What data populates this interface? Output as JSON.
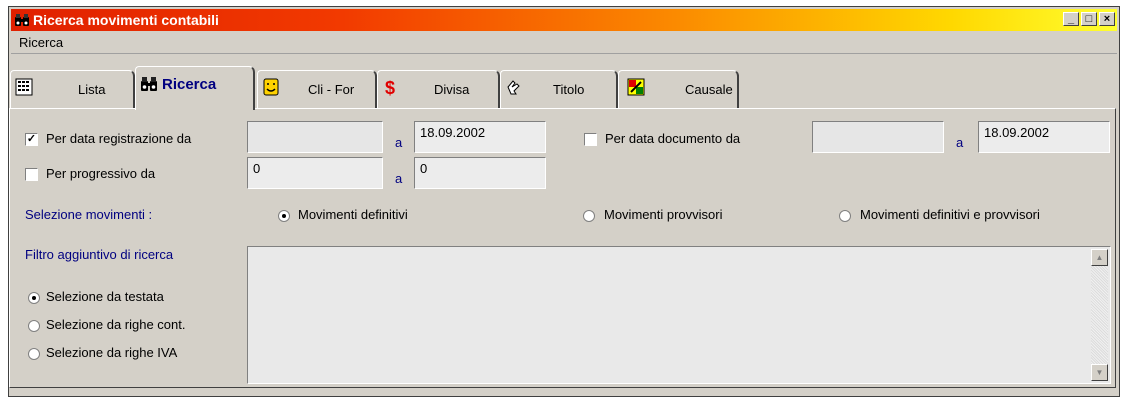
{
  "window": {
    "title": "Ricerca movimenti contabili"
  },
  "menu": {
    "items": [
      "Ricerca"
    ]
  },
  "tabs": [
    {
      "label": "Lista",
      "icon": "grid-list-icon"
    },
    {
      "label": "Ricerca",
      "icon": "binoculars-icon",
      "active": true
    },
    {
      "label": "Cli - For",
      "icon": "face-icon"
    },
    {
      "label": "Divisa",
      "icon": "dollar-icon"
    },
    {
      "label": "Titolo",
      "icon": "hand-icon"
    },
    {
      "label": "Causale",
      "icon": "ledger-icon"
    }
  ],
  "form": {
    "data_reg": {
      "label": "Per data registrazione da",
      "checked": true,
      "from": "",
      "to_label": "a",
      "to": "18.09.2002"
    },
    "progressivo": {
      "label": "Per progressivo da",
      "checked": false,
      "from": "0",
      "to_label": "a",
      "to": "0"
    },
    "data_doc": {
      "label": "Per data documento  da",
      "checked": false,
      "from": "",
      "to_label": "a",
      "to": "18.09.2002"
    },
    "selezione_label": "Selezione movimenti :",
    "selezione_options": [
      {
        "label": "Movimenti definitivi",
        "selected": true
      },
      {
        "label": "Movimenti provvisori",
        "selected": false
      },
      {
        "label": "Movimenti definitivi e provvisori",
        "selected": false
      }
    ],
    "filtro_label": "Filtro aggiuntivo di ricerca",
    "filtro_options": [
      {
        "label": "Selezione da testata",
        "selected": true
      },
      {
        "label": "Selezione da righe cont.",
        "selected": false
      },
      {
        "label": "Selezione da righe IVA",
        "selected": false
      }
    ],
    "filtro_text": ""
  },
  "colors": {
    "title_gradient_start": "#e02000",
    "title_gradient_end": "#ffff30",
    "label_blue": "#000080",
    "face": "#d4d0c8"
  }
}
